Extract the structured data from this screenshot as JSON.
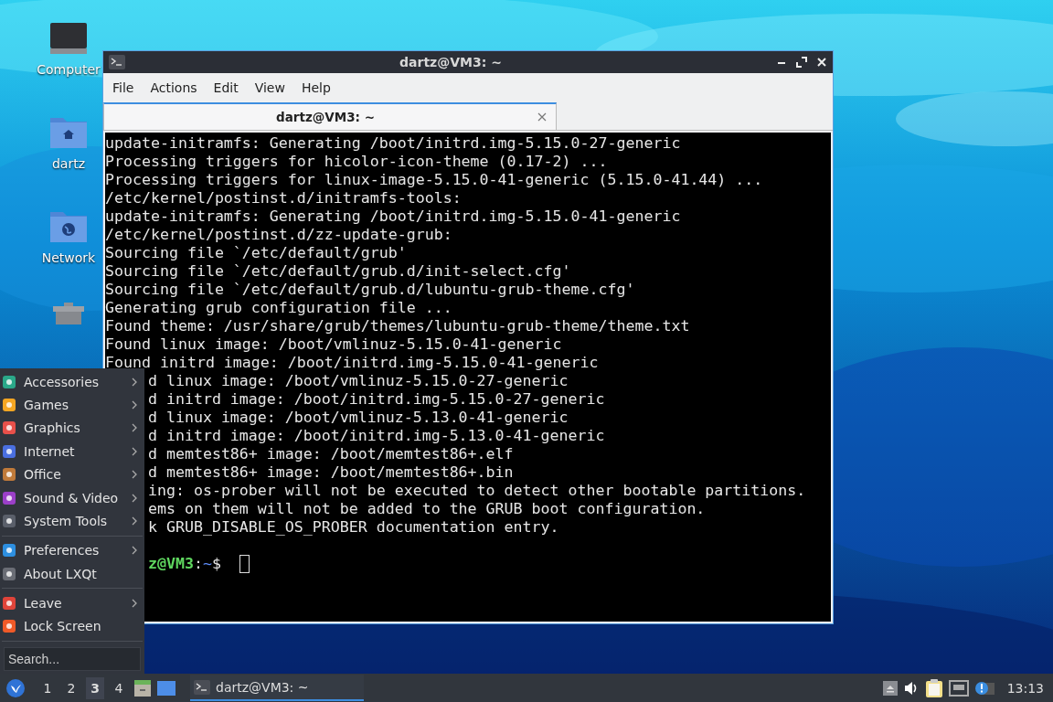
{
  "desktop_icons": [
    {
      "kind": "computer",
      "label": "Computer"
    },
    {
      "kind": "home",
      "label": "dartz"
    },
    {
      "kind": "network",
      "label": "Network"
    },
    {
      "kind": "trash"
    }
  ],
  "window": {
    "title": "dartz@VM3: ~",
    "menu": [
      "File",
      "Actions",
      "Edit",
      "View",
      "Help"
    ],
    "tabs": [
      {
        "label": "dartz@VM3: ~",
        "selected": true
      }
    ],
    "lines": [
      {
        "text": "update-initramfs: Generating /boot/initrd.img-5.15.0-27-generic",
        "clipped": false
      },
      {
        "text": "Processing triggers for hicolor-icon-theme (0.17-2) ...",
        "clipped": false
      },
      {
        "text": "Processing triggers for linux-image-5.15.0-41-generic (5.15.0-41.44) ...",
        "clipped": false
      },
      {
        "text": "/etc/kernel/postinst.d/initramfs-tools:",
        "clipped": false
      },
      {
        "text": "update-initramfs: Generating /boot/initrd.img-5.15.0-41-generic",
        "clipped": false
      },
      {
        "text": "/etc/kernel/postinst.d/zz-update-grub:",
        "clipped": false
      },
      {
        "text": "Sourcing file `/etc/default/grub'",
        "clipped": false
      },
      {
        "text": "Sourcing file `/etc/default/grub.d/init-select.cfg'",
        "clipped": false
      },
      {
        "text": "Sourcing file `/etc/default/grub.d/lubuntu-grub-theme.cfg'",
        "clipped": false
      },
      {
        "text": "Generating grub configuration file ...",
        "clipped": false
      },
      {
        "text": "Found theme: /usr/share/grub/themes/lubuntu-grub-theme/theme.txt",
        "clipped": false
      },
      {
        "text": "Found linux image: /boot/vmlinuz-5.15.0-41-generic",
        "clipped": false
      },
      {
        "text": "Found initrd image: /boot/initrd.img-5.15.0-41-generic",
        "clipped": false
      },
      {
        "text": "d linux image: /boot/vmlinuz-5.15.0-27-generic",
        "clipped": true
      },
      {
        "text": "d initrd image: /boot/initrd.img-5.15.0-27-generic",
        "clipped": true
      },
      {
        "text": "d linux image: /boot/vmlinuz-5.13.0-41-generic",
        "clipped": true
      },
      {
        "text": "d initrd image: /boot/initrd.img-5.13.0-41-generic",
        "clipped": true
      },
      {
        "text": "d memtest86+ image: /boot/memtest86+.elf",
        "clipped": true
      },
      {
        "text": "d memtest86+ image: /boot/memtest86+.bin",
        "clipped": true
      },
      {
        "text": "ing: os-prober will not be executed to detect other bootable partitions.",
        "clipped": true
      },
      {
        "text": "ems on them will not be added to the GRUB boot configuration.",
        "clipped": true
      },
      {
        "text": "k GRUB_DISABLE_OS_PROBER documentation entry.",
        "clipped": true
      }
    ],
    "prompt": {
      "user_host": "z@VM3",
      "separator": ":",
      "path": "~",
      "symbol": "$",
      "clipped": true
    }
  },
  "menu": {
    "groups": [
      [
        {
          "kind": "accessories",
          "label": "Accessories",
          "submenu": true
        },
        {
          "kind": "games",
          "label": "Games",
          "submenu": true
        },
        {
          "kind": "graphics",
          "label": "Graphics",
          "submenu": true
        },
        {
          "kind": "internet",
          "label": "Internet",
          "submenu": true
        },
        {
          "kind": "office",
          "label": "Office",
          "submenu": true
        },
        {
          "kind": "sound",
          "label": "Sound & Video",
          "submenu": true
        },
        {
          "kind": "system",
          "label": "System Tools",
          "submenu": true
        }
      ],
      [
        {
          "kind": "preferences",
          "label": "Preferences",
          "submenu": true
        },
        {
          "kind": "about",
          "label": "About LXQt",
          "submenu": false
        }
      ],
      [
        {
          "kind": "leave",
          "label": "Leave",
          "submenu": true
        },
        {
          "kind": "lock",
          "label": "Lock Screen",
          "submenu": false
        }
      ]
    ],
    "search": {
      "placeholder": "Search..."
    }
  },
  "taskbar": {
    "desktops": [
      {
        "label": "1",
        "selected": false
      },
      {
        "label": "2",
        "selected": false
      },
      {
        "label": "3",
        "selected": true
      },
      {
        "label": "4",
        "selected": false
      }
    ],
    "tasks": [
      {
        "label": "dartz@VM3: ~",
        "selected": true
      }
    ],
    "clock": "13:13"
  }
}
